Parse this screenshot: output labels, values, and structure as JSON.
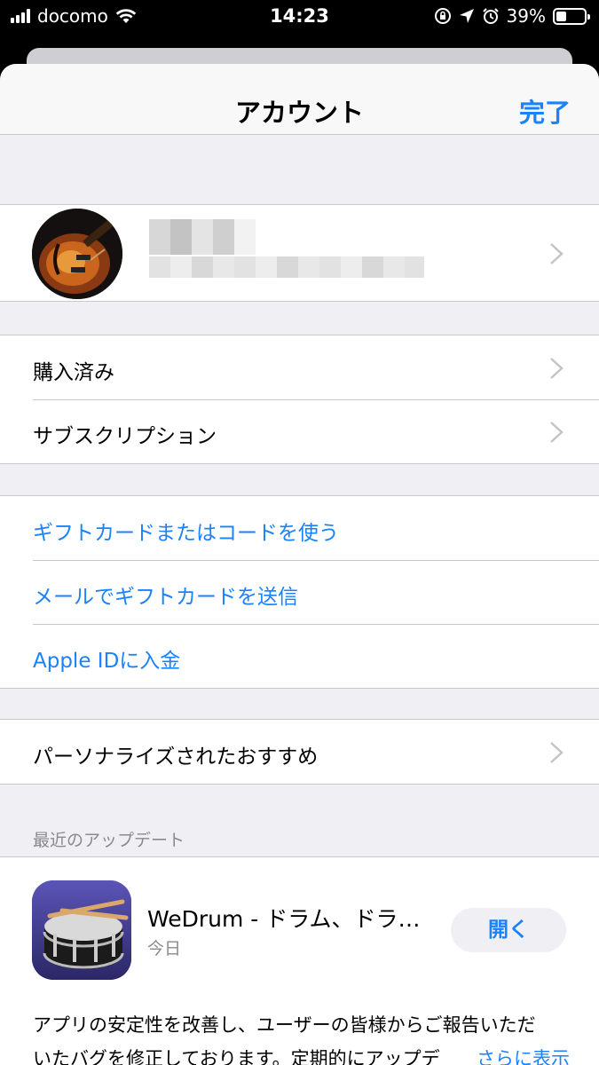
{
  "status_bar": {
    "carrier": "docomo",
    "time": "14:23",
    "battery": "39%"
  },
  "nav": {
    "title": "アカウント",
    "done": "完了"
  },
  "groups": {
    "purchases": [
      {
        "label": "購入済み"
      },
      {
        "label": "サブスクリプション"
      }
    ],
    "gift": [
      {
        "label": "ギフトカードまたはコードを使う"
      },
      {
        "label": "メールでギフトカードを送信"
      },
      {
        "label": "Apple IDに入金"
      }
    ],
    "personal": [
      {
        "label": "パーソナライズされたおすすめ"
      }
    ]
  },
  "recent_updates": {
    "header": "最近のアップデート",
    "app_name": "WeDrum - ドラム、ドラ…",
    "date": "今日",
    "open_label": "開く",
    "notes_line1": "アプリの安定性を改善し、ユーザーの皆様からご報告いただ",
    "notes_line2": "いたバグを修正しております。定期的にアップデ",
    "more_label": "さらに表示"
  },
  "colors": {
    "accent": "#1a82fb",
    "background": "#efeff4",
    "separator": "#c8c7cc"
  }
}
